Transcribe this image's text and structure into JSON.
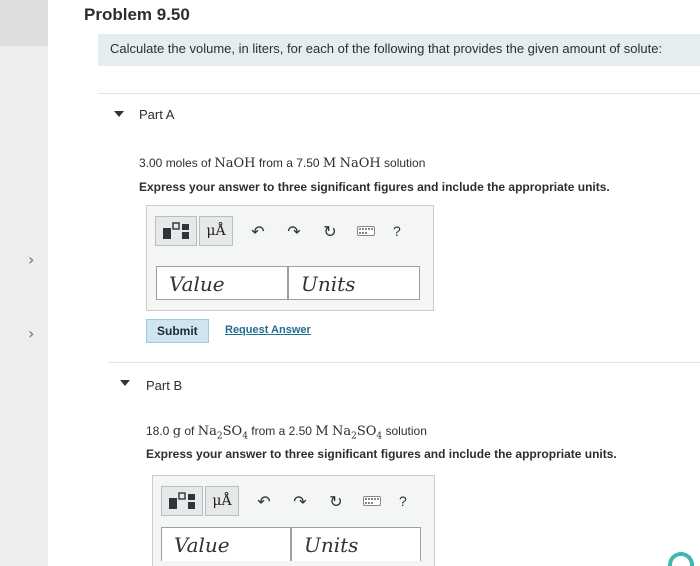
{
  "problem": {
    "title": "Problem 9.50"
  },
  "instruction": "Calculate the volume, in liters, for each of the following that provides the given amount of solute:",
  "parts": [
    {
      "label": "Part A",
      "q_amount": "3.00 moles of",
      "q_solute": "NaOH",
      "q_from": "from a 7.50",
      "q_unit": "M",
      "q_solution": "NaOH",
      "q_end": "solution",
      "directive": "Express your answer to three significant figures and include the appropriate units.",
      "value_placeholder": "Value",
      "units_placeholder": "Units",
      "submit_label": "Submit",
      "request_label": "Request Answer",
      "toolbar": {
        "mu_label": "μÅ",
        "help_label": "?"
      }
    },
    {
      "label": "Part B",
      "q_amount": "18.0",
      "q_g": "g",
      "q_of": "of",
      "q_from": "from a 2.50",
      "q_unit": "M",
      "q_end": "solution",
      "directive": "Express your answer to three significant figures and include the appropriate units.",
      "value_placeholder": "Value",
      "units_placeholder": "Units",
      "toolbar": {
        "mu_label": "μÅ",
        "help_label": "?"
      }
    }
  ],
  "icons": {
    "rail_chevron": "chevron-right-icon",
    "template": "template-icon",
    "undo": "undo-icon",
    "redo": "redo-icon",
    "reset": "reset-icon",
    "keyboard": "keyboard-icon"
  },
  "colors": {
    "instruction_bg": "#e4eef0",
    "submit_bg": "#cfe5ee",
    "link": "#1f6f8f"
  }
}
